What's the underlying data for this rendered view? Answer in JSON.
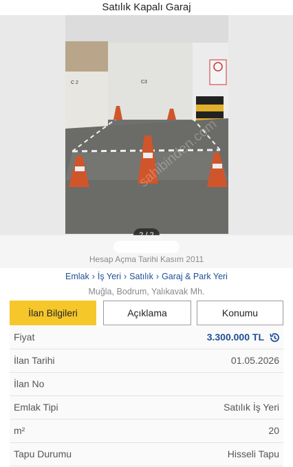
{
  "header": {
    "title": "Satılık Kapalı Garaj"
  },
  "gallery": {
    "pager": "2 / 2"
  },
  "account": {
    "opening_date": "Hesap Açma Tarihi  Kasım 2011"
  },
  "breadcrumb": {
    "items": [
      "Emlak",
      "İş Yeri",
      "Satılık",
      "Garaj & Park Yeri"
    ],
    "separator": "›"
  },
  "location": "Muğla, Bodrum, Yalıkavak Mh.",
  "tabs": [
    {
      "label": "İlan Bilgileri",
      "active": true
    },
    {
      "label": "Açıklama",
      "active": false
    },
    {
      "label": "Konumu",
      "active": false
    }
  ],
  "details": [
    {
      "label": "Fiyat",
      "value": "3.300.000 TL"
    },
    {
      "label": "İlan Tarihi",
      "value": "01.05.2026"
    },
    {
      "label": "İlan No",
      "value": ""
    },
    {
      "label": "Emlak Tipi",
      "value": "Satılık İş Yeri"
    },
    {
      "label": "m²",
      "value": "20"
    },
    {
      "label": "Tapu Durumu",
      "value": "Hisseli Tapu"
    }
  ],
  "colors": {
    "accent": "#f6c72a",
    "link": "#1d4e97"
  },
  "icons": {
    "price_history": "history-icon"
  }
}
